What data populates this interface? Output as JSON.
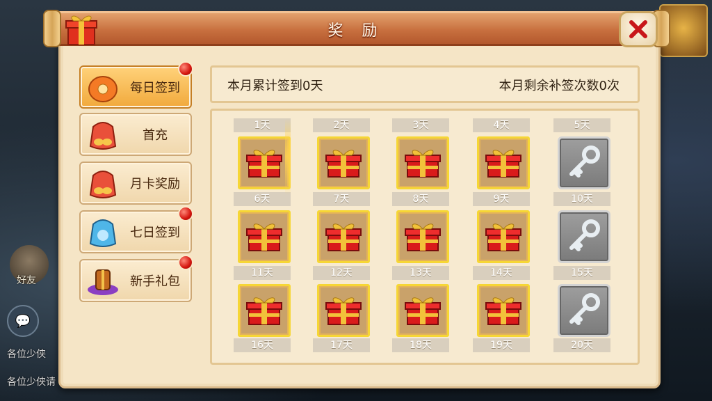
{
  "dialog": {
    "title": "奖 励"
  },
  "background": {
    "friend_label": "好友",
    "chat_lines": [
      "各位少侠",
      "各位少侠请"
    ]
  },
  "sidebar": {
    "items": [
      {
        "label": "每日签到",
        "icon": "coin-pouch-icon",
        "has_badge": true,
        "active": true
      },
      {
        "label": "首充",
        "icon": "money-bag-icon",
        "has_badge": false,
        "active": false
      },
      {
        "label": "月卡奖励",
        "icon": "money-bag-icon",
        "has_badge": false,
        "active": false
      },
      {
        "label": "七日签到",
        "icon": "blue-bag-icon",
        "has_badge": true,
        "active": false
      },
      {
        "label": "新手礼包",
        "icon": "purple-gift-icon",
        "has_badge": true,
        "active": false
      }
    ]
  },
  "info": {
    "signed_days": "本月累计签到0天",
    "remaining_makeups": "本月剩余补签次数0次"
  },
  "rewards": {
    "rows": [
      [
        {
          "day": "1天",
          "item": "gift"
        },
        {
          "day": "2天",
          "item": "gift"
        },
        {
          "day": "3天",
          "item": "gift"
        },
        {
          "day": "4天",
          "item": "gift"
        },
        {
          "day": "5天",
          "item": "key"
        }
      ],
      [
        {
          "day": "6天",
          "item": "gift"
        },
        {
          "day": "7天",
          "item": "gift"
        },
        {
          "day": "8天",
          "item": "gift"
        },
        {
          "day": "9天",
          "item": "gift"
        },
        {
          "day": "10天",
          "item": "key"
        }
      ],
      [
        {
          "day": "11天",
          "item": "gift"
        },
        {
          "day": "12天",
          "item": "gift"
        },
        {
          "day": "13天",
          "item": "gift"
        },
        {
          "day": "14天",
          "item": "gift"
        },
        {
          "day": "15天",
          "item": "key"
        }
      ]
    ],
    "next_row_labels": [
      "16天",
      "17天",
      "18天",
      "19天",
      "20天"
    ]
  },
  "colors": {
    "title_bar": "#c8703f",
    "panel_bg": "#f5e5c6",
    "gift_red": "#d91b1b",
    "gift_ribbon": "#f2c23a",
    "badge_red": "#d4150e",
    "item_border": "#f6d635"
  }
}
